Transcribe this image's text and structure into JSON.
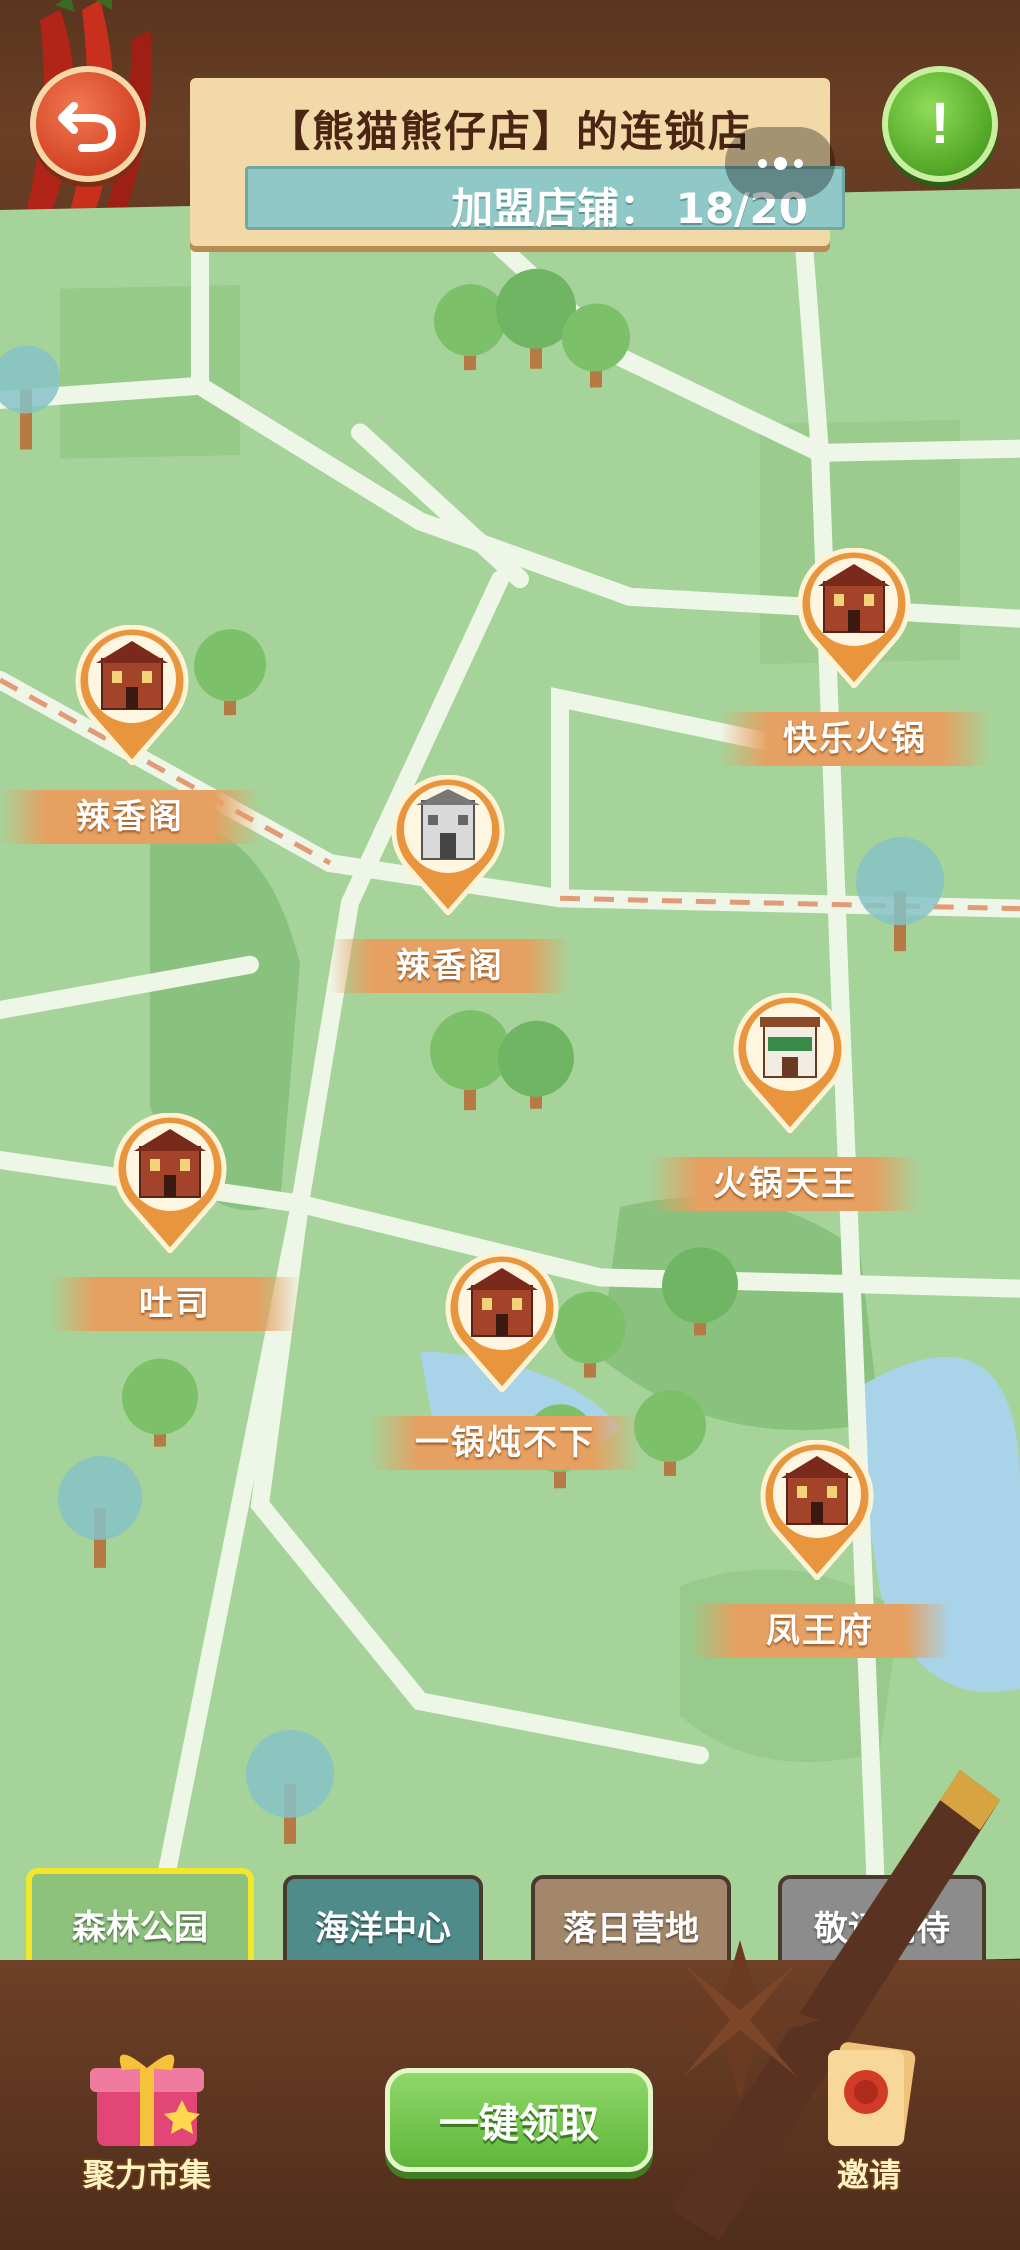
{
  "header": {
    "title": "【熊猫熊仔店】的连锁店",
    "franchise_label": "加盟店铺：",
    "franchise_count": "18/20"
  },
  "stores": [
    {
      "name": "辣香阁",
      "icon": "chinese-restaurant-icon"
    },
    {
      "name": "快乐火锅",
      "icon": "chinese-restaurant-icon"
    },
    {
      "name": "辣香阁",
      "icon": "gray-pagoda-building-icon"
    },
    {
      "name": "火锅天王",
      "icon": "small-shop-icon"
    },
    {
      "name": "吐司",
      "icon": "chinese-restaurant-icon"
    },
    {
      "name": "一锅炖不下",
      "icon": "chinese-restaurant-icon"
    },
    {
      "name": "凤王府",
      "icon": "chinese-restaurant-icon"
    }
  ],
  "regions": [
    {
      "label": "森林公园",
      "selected": true
    },
    {
      "label": "海洋中心",
      "selected": false
    },
    {
      "label": "落日营地",
      "selected": false
    },
    {
      "label": "敬请期待",
      "selected": false
    }
  ],
  "bottom_bar": {
    "market_label": "聚力市集",
    "claim_label": "一键领取",
    "invite_label": "邀请"
  },
  "colors": {
    "map_green": "#a6d39a",
    "pin_orange": "#e9953d",
    "selected_border": "#f4e62a"
  }
}
